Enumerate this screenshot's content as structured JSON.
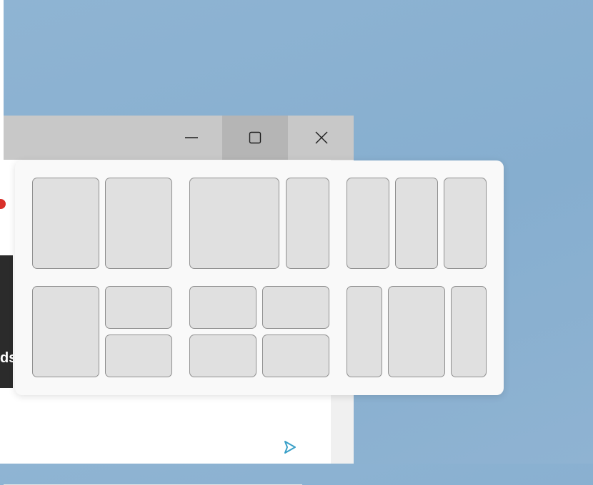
{
  "window": {
    "title_controls": {
      "minimize": "minimize",
      "maximize": "maximize",
      "close": "close"
    },
    "partial_text": "ds"
  },
  "colors": {
    "desktop": "#8fb4d3",
    "titlebar": "#c8c8c8",
    "maximize_hover": "#b5b5b5",
    "zone_fill": "#e0e0e0",
    "zone_border": "#8f8f8f",
    "accent": "#3aa0c8"
  },
  "snap_layouts": [
    {
      "name": "layout-halves",
      "zones": 2
    },
    {
      "name": "layout-wide-left",
      "zones": 2
    },
    {
      "name": "layout-three-columns",
      "zones": 3
    },
    {
      "name": "layout-left-and-stacked-right",
      "zones": 3
    },
    {
      "name": "layout-quadrants",
      "zones": 4
    },
    {
      "name": "layout-wide-center",
      "zones": 3
    }
  ]
}
